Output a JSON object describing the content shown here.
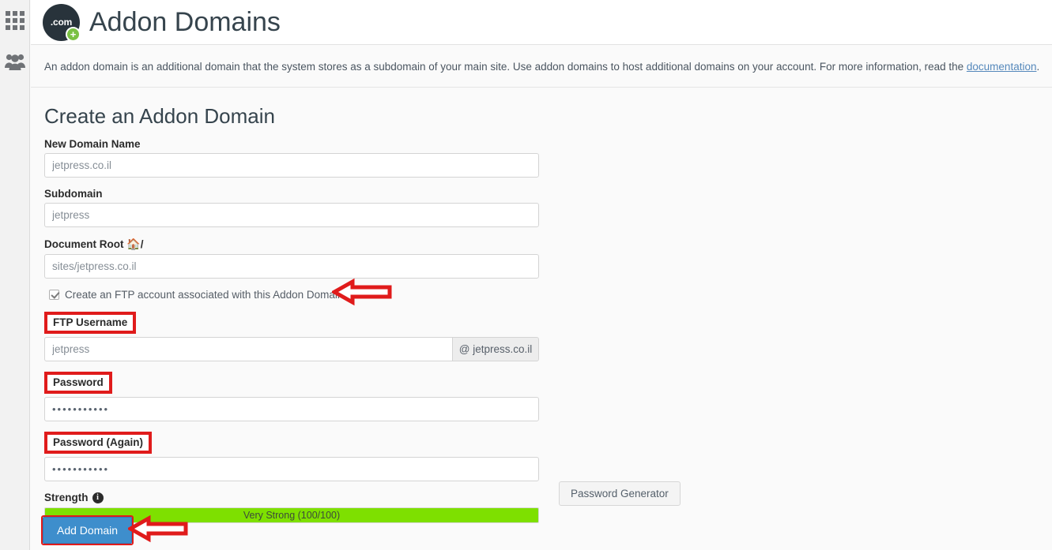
{
  "sidebar": {
    "items": [
      {
        "name": "apps-grid",
        "icon": "grid-icon",
        "label": ""
      },
      {
        "name": "users",
        "icon": "users-icon",
        "label": ""
      }
    ]
  },
  "header": {
    "title": "Addon Domains",
    "badge_text": ".com",
    "badge_plus": "+"
  },
  "description": {
    "text_before": "An addon domain is an additional domain that the system stores as a subdomain of your main site. Use addon domains to host additional domains on your account. For more information, read the ",
    "link_text": "documentation",
    "text_after": "."
  },
  "form": {
    "section_title": "Create an Addon Domain",
    "new_domain": {
      "label": "New Domain Name",
      "value": "jetpress.co.il",
      "placeholder": "jetpress.co.il"
    },
    "subdomain": {
      "label": "Subdomain",
      "value": "jetpress",
      "placeholder": "jetpress"
    },
    "document_root": {
      "label_prefix": "Document Root",
      "label_suffix": "/",
      "home_icon": "home-icon",
      "value": "sites/jetpress.co.il",
      "placeholder": "sites/jetpress.co.il"
    },
    "ftp_checkbox": {
      "label": "Create an FTP account associated with this Addon Domain.",
      "checked": true
    },
    "ftp_username": {
      "label": "FTP Username",
      "value": "jetpress",
      "placeholder": "jetpress",
      "addon": "@ jetpress.co.il",
      "highlighted": true
    },
    "password": {
      "label": "Password",
      "value": "•••••••••••",
      "highlighted": true
    },
    "password_again": {
      "label": "Password (Again)",
      "value": "•••••••••••",
      "highlighted": true
    },
    "strength": {
      "label": "Strength",
      "info_icon": "info-icon",
      "bar_text": "Very Strong (100/100)",
      "percent": 100,
      "bar_color": "#7ee000"
    },
    "password_generator_label": "Password Generator",
    "submit_label": "Add Domain"
  },
  "annotations": {
    "arrow_checkbox": "red-left-arrow pointing at FTP account checkbox row",
    "arrow_submit": "red-left-arrow pointing at Add Domain button",
    "highlight_color": "#e01b1b"
  }
}
